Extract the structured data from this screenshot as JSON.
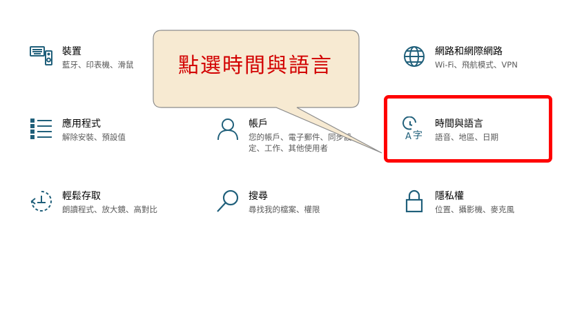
{
  "tiles": {
    "devices": {
      "title": "裝置",
      "desc": "藍牙、印表機、滑鼠",
      "icon": "keyboard-speaker-icon"
    },
    "network": {
      "title": "網路和網際網路",
      "desc": "Wi-Fi、飛航模式、VPN",
      "icon": "globe-icon"
    },
    "apps": {
      "title": "應用程式",
      "desc": "解除安裝、預設值",
      "icon": "app-list-icon"
    },
    "accounts": {
      "title": "帳戶",
      "desc": "您的帳戶、電子郵件、同步設定、工作、其他使用者",
      "icon": "person-icon"
    },
    "time": {
      "title": "時間與語言",
      "desc": "語音、地區、日期",
      "icon": "time-language-icon"
    },
    "ease": {
      "title": "輕鬆存取",
      "desc": "朗讀程式、放大鏡、高對比",
      "icon": "ease-of-access-icon"
    },
    "search": {
      "title": "搜尋",
      "desc": "尋找我的檔案、權限",
      "icon": "search-icon"
    },
    "privacy": {
      "title": "隱私權",
      "desc": "位置、攝影機、麥克風",
      "icon": "lock-icon"
    }
  },
  "callout": {
    "text": "點選時間與語言"
  },
  "colors": {
    "icon": "#1f5f7a",
    "highlight": "#ff0000",
    "callout_fill": "#f7ead2",
    "callout_text": "#d20000"
  }
}
